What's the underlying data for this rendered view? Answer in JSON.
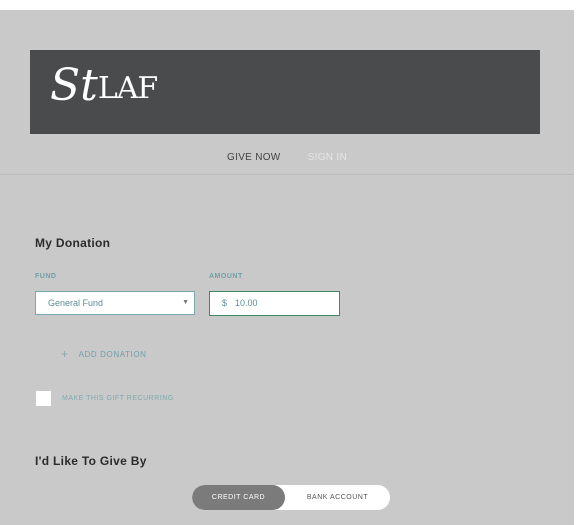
{
  "logo": {
    "text_big": "St",
    "text_rest": "LAF"
  },
  "nav": {
    "give_now": "GIVE NOW",
    "sign_in": "SIGN IN"
  },
  "donation": {
    "title": "My Donation",
    "fund_label": "FUND",
    "fund_value": "General Fund",
    "amount_label": "AMOUNT",
    "amount_currency": "$",
    "amount_value": "10.00",
    "add_donation": "ADD DONATION",
    "recurring_label": "MAKE THIS GIFT RECURRING",
    "recurring_checked": false
  },
  "payment": {
    "title": "I'd Like To Give By",
    "options": [
      "CREDIT CARD",
      "BANK ACCOUNT"
    ],
    "selected": "CREDIT CARD"
  },
  "colors": {
    "background": "#c9c9c9",
    "banner": "#4a4b4d",
    "accent": "#6fa0a7",
    "active_toggle": "#7b7b7b"
  },
  "icons": {
    "dropdown": "chevron-down-icon",
    "add": "plus-icon"
  }
}
